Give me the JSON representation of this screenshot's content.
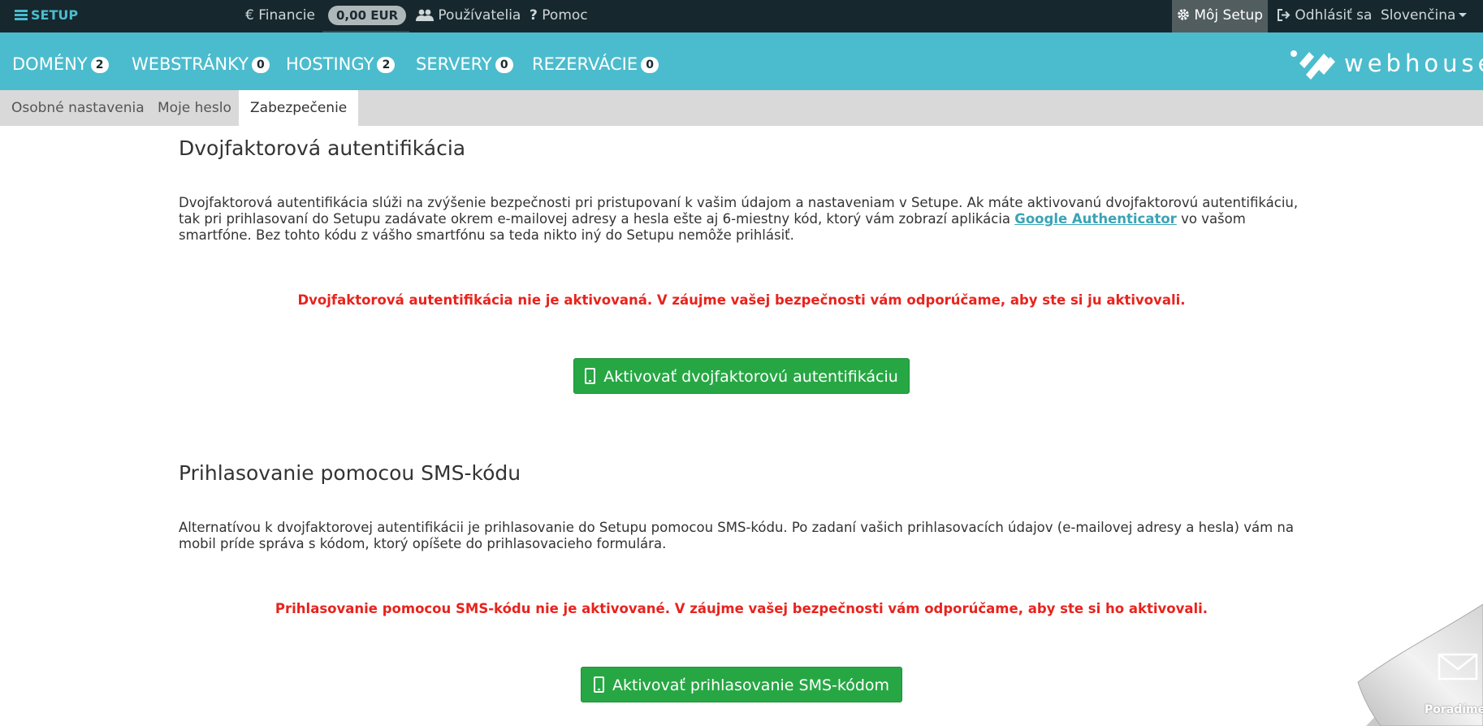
{
  "topbar": {
    "brand": "SETUP",
    "finance": "Financie",
    "balance": "0,00 EUR",
    "users": "Používatelia",
    "help": "Pomoc",
    "my_setup": "Môj Setup",
    "logout": "Odhlásiť sa",
    "language": "Slovenčina"
  },
  "mainnav": {
    "items": [
      {
        "label": "DOMÉNY",
        "count": "2"
      },
      {
        "label": "WEBSTRÁNKY",
        "count": "0"
      },
      {
        "label": "HOSTINGY",
        "count": "2"
      },
      {
        "label": "SERVERY",
        "count": "0"
      },
      {
        "label": "REZERVÁCIE",
        "count": "0"
      }
    ],
    "logo_text": "webhouse"
  },
  "subnav": {
    "tabs": [
      "Osobné nastavenia",
      "Moje heslo",
      "Zabezpečenie"
    ],
    "active": "Zabezpečenie"
  },
  "twofa": {
    "title": "Dvojfaktorová autentifikácia",
    "text_before": "Dvojfaktorová autentifikácia slúži na zvýšenie bezpečnosti pri pristupovaní k vašim údajom a nastaveniam v Setupe. Ak máte aktivovanú dvojfaktorovú autentifikáciu, tak pri prihlasovaní do Setupu zadávate okrem e-mailovej adresy a hesla ešte aj 6-miestny kód, ktorý vám zobrazí aplikácia ",
    "link": "Google Authenticator",
    "text_after": " vo vašom smartfóne. Bez tohto kódu z vášho smartfónu sa teda nikto iný do Setupu nemôže prihlásiť.",
    "warning": "Dvojfaktorová autentifikácia nie je aktivovaná. V záujme vašej bezpečnosti vám odporúčame, aby ste si ju aktivovali.",
    "button": "Aktivovať dvojfaktorovú autentifikáciu"
  },
  "sms": {
    "title": "Prihlasovanie pomocou SMS-kódu",
    "text": "Alternatívou k dvojfaktorovej autentifikácii je prihlasovanie do Setupu pomocou SMS-kódu. Po zadaní vašich prihlasovacích údajov (e-mailovej adresy a hesla) vám na mobil príde správa s kódom, ktorý opíšete do prihlasovacieho formulára.",
    "warning": "Prihlasovanie pomocou SMS-kódu nie je aktivované. V záujme vašej bezpečnosti vám odporúčame, aby ste si ho aktivovali.",
    "button": "Aktivovať prihlasovanie SMS-kódom"
  },
  "corner": {
    "label": "Poradíme?"
  },
  "colors": {
    "topbar": "#16282d",
    "accent": "#4bbccd",
    "success": "#27a744",
    "danger": "#e8231d"
  }
}
